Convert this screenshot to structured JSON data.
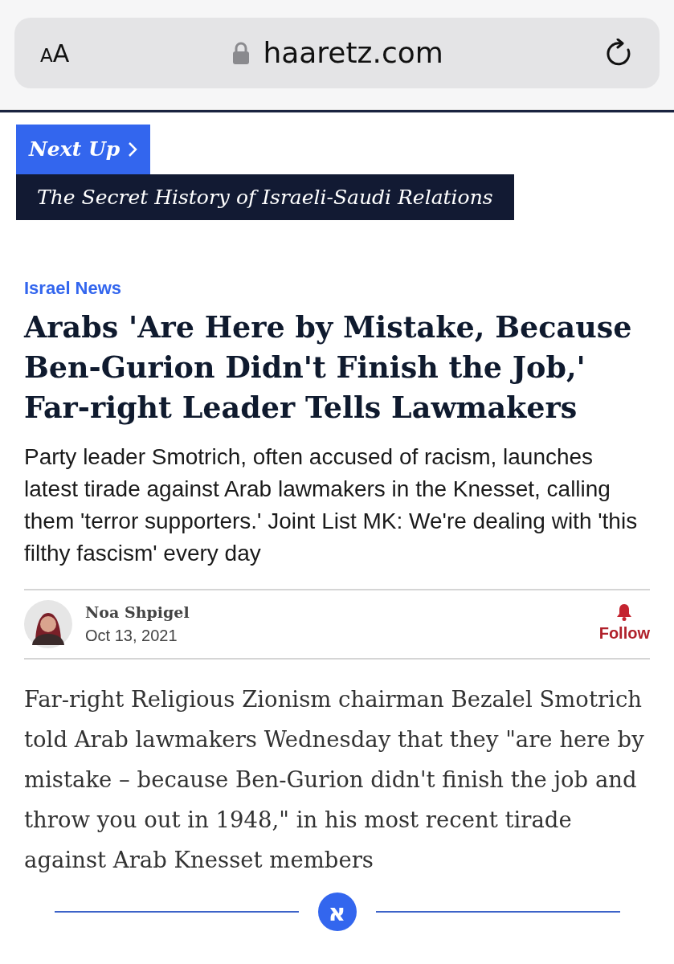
{
  "browser": {
    "text_size_label": "AA",
    "address": "haaretz.com"
  },
  "next_up": {
    "label": "Next Up",
    "title": "The Secret History of Israeli-Saudi Relations"
  },
  "article": {
    "category": "Israel News",
    "headline": "Arabs 'Are Here by Mistake, Because Ben-Gurion Didn't Finish the Job,' Far-right Leader Tells Lawmakers",
    "subtitle": "Party leader Smotrich, often accused of racism, launches latest tirade against Arab lawmakers in the Knesset, calling them 'terror supporters.' Joint List MK: We're dealing with 'this filthy fascism' every day",
    "author": {
      "name": "Noa Shpigel",
      "date": "Oct 13, 2021",
      "follow_label": "Follow"
    },
    "body": "Far-right Religious Zionism chairman Bezalel Smotrich told Arab lawmakers Wednesday that they \"are here by mistake – because Ben-Gurion didn't finish the job and throw you out in 1948,\" in his most recent tirade against Arab Knesset members"
  },
  "footer": {
    "logo_glyph": "א"
  }
}
